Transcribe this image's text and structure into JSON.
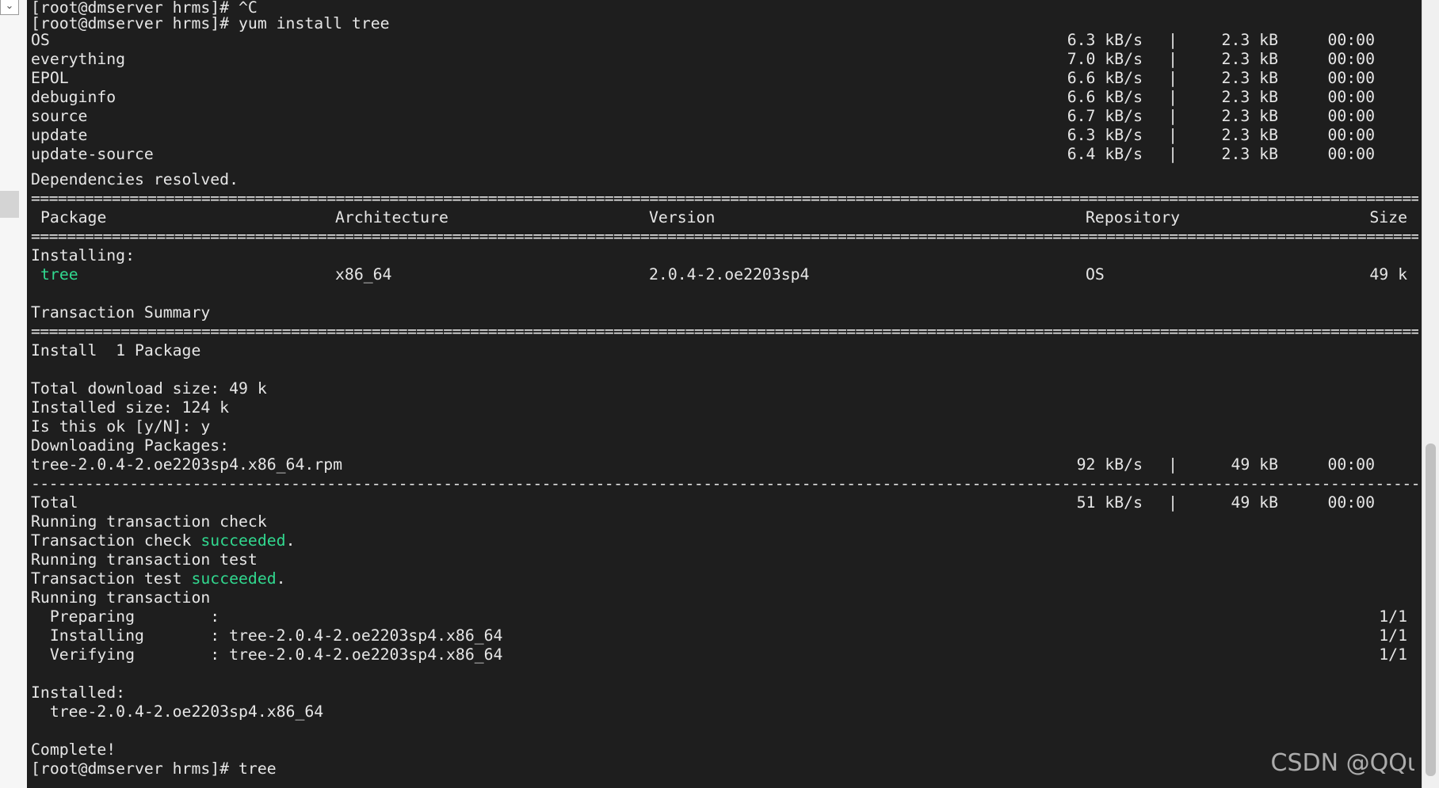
{
  "terminal": {
    "prompt_1": "[root@dmserver hrms]# ^C",
    "prompt_2": "[root@dmserver hrms]# yum install tree",
    "repos": [
      {
        "name": "OS",
        "rate": "6.3 kB/s",
        "sep": "|",
        "size": "2.3 kB",
        "time": "00:00"
      },
      {
        "name": "everything",
        "rate": "7.0 kB/s",
        "sep": "|",
        "size": "2.3 kB",
        "time": "00:00"
      },
      {
        "name": "EPOL",
        "rate": "6.6 kB/s",
        "sep": "|",
        "size": "2.3 kB",
        "time": "00:00"
      },
      {
        "name": "debuginfo",
        "rate": "6.6 kB/s",
        "sep": "|",
        "size": "2.3 kB",
        "time": "00:00"
      },
      {
        "name": "source",
        "rate": "6.7 kB/s",
        "sep": "|",
        "size": "2.3 kB",
        "time": "00:00"
      },
      {
        "name": "update",
        "rate": "6.3 kB/s",
        "sep": "|",
        "size": "2.3 kB",
        "time": "00:00"
      },
      {
        "name": "update-source",
        "rate": "6.4 kB/s",
        "sep": "|",
        "size": "2.3 kB",
        "time": "00:00"
      }
    ],
    "deps_resolved": "Dependencies resolved.",
    "double_rule": "=========================================================================================================================================================================",
    "dash_rule": "-------------------------------------------------------------------------------------------------------------------------------------------------------------------------",
    "table_headers": {
      "package": "Package",
      "arch": "Architecture",
      "version": "Version",
      "repo": "Repository",
      "size": "Size"
    },
    "installing_label": "Installing:",
    "pkg_row": {
      "package": "tree",
      "arch": "x86_64",
      "version": "2.0.4-2.oe2203sp4",
      "repo": "OS",
      "size": "49 k"
    },
    "transaction_summary": "Transaction Summary",
    "install_count": "Install  1 Package",
    "total_download": "Total download size: 49 k",
    "installed_size": "Installed size: 124 k",
    "confirm": "Is this ok [y/N]: y",
    "downloading": "Downloading Packages:",
    "rpm_line": {
      "name": "tree-2.0.4-2.oe2203sp4.x86_64.rpm",
      "rate": "92 kB/s",
      "sep": "|",
      "size": "49 kB",
      "time": "00:00"
    },
    "total_line": {
      "name": "Total",
      "rate": "51 kB/s",
      "sep": "|",
      "size": "49 kB",
      "time": "00:00"
    },
    "running_check": "Running transaction check",
    "check_prefix": "Transaction check ",
    "succeeded": "succeeded",
    "period": ".",
    "running_test": "Running transaction test",
    "test_prefix": "Transaction test ",
    "running_transaction": "Running transaction",
    "steps": [
      {
        "text": "  Preparing        :",
        "frac": "1/1"
      },
      {
        "text": "  Installing       : tree-2.0.4-2.oe2203sp4.x86_64",
        "frac": "1/1"
      },
      {
        "text": "  Verifying        : tree-2.0.4-2.oe2203sp4.x86_64",
        "frac": "1/1"
      }
    ],
    "installed_label": "Installed:",
    "installed_pkg": "  tree-2.0.4-2.oe2203sp4.x86_64",
    "complete": "Complete!",
    "prompt_3": "[root@dmserver hrms]# tree"
  },
  "watermark": "CSDN @QQι",
  "gutter_arrow": "⌄",
  "colors": {
    "background": "#1e1e1e",
    "foreground": "#e6e6e6",
    "green": "#31d88f"
  }
}
